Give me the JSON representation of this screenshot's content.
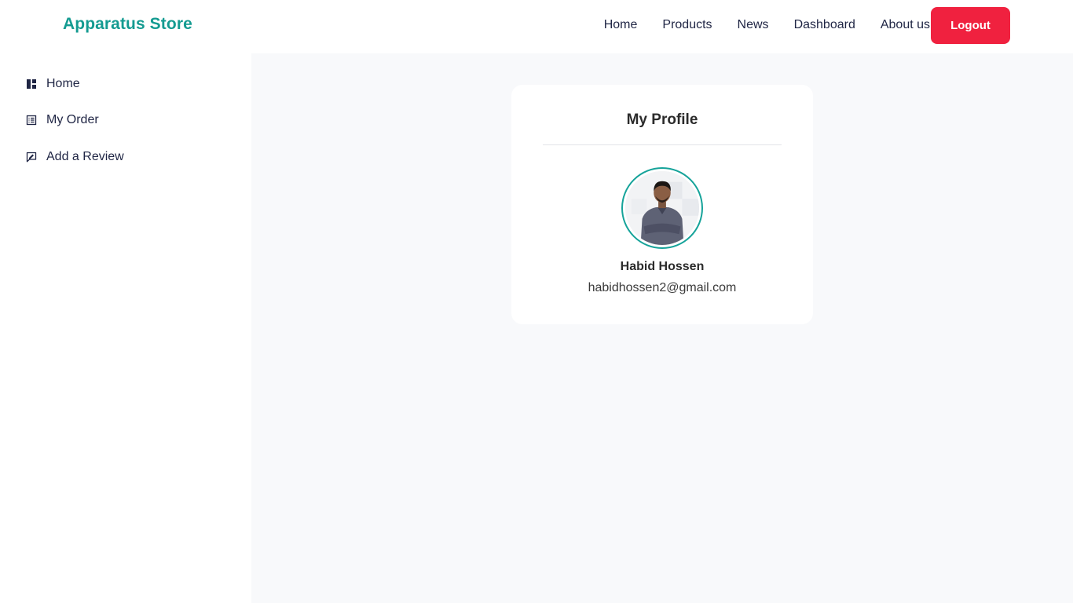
{
  "brand": {
    "name": "Apparatus Store",
    "color": "#149b91"
  },
  "nav": {
    "links": [
      {
        "label": "Home"
      },
      {
        "label": "Products"
      },
      {
        "label": "News"
      },
      {
        "label": "Dashboard"
      },
      {
        "label": "About us"
      }
    ],
    "logout_label": "Logout",
    "logout_color": "#f0213f"
  },
  "sidebar": {
    "items": [
      {
        "label": "Home",
        "icon": "dashboard-icon"
      },
      {
        "label": "My Order",
        "icon": "list-icon"
      },
      {
        "label": "Add a Review",
        "icon": "review-icon"
      }
    ]
  },
  "profile": {
    "title": "My Profile",
    "avatar_icon": "user-avatar-photo",
    "name": "Habid Hossen",
    "email": "habidhossen2@gmail.com"
  }
}
